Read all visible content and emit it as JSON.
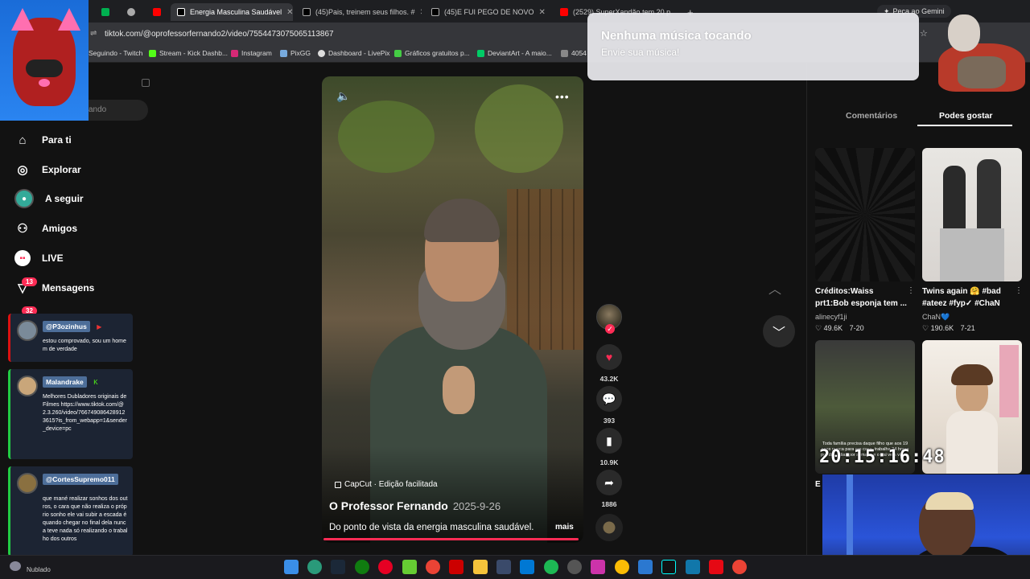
{
  "browser": {
    "tabs": [
      {
        "label": "",
        "active": false
      },
      {
        "label": "",
        "active": false
      },
      {
        "label": "",
        "active": false
      },
      {
        "label": "Energia Masculina Saudável",
        "active": true
      },
      {
        "label": "(45)Pais, treinem seus filhos. #",
        "active": false
      },
      {
        "label": "(45)E FUI PEGO DE NOVO",
        "active": false
      },
      {
        "label": "(2529) SuperXandão tem 20 p",
        "active": false
      }
    ],
    "gemini_label": "Peça ao Gemini",
    "url": "tiktok.com/@oprofessorfernando2/video/7554473075065113867",
    "bookmarks": [
      "Seguindo - Twitch",
      "Stream - Kick Dashb...",
      "Instagram",
      "PixGG",
      "Dashboard - LivePix",
      "Gráficos gratuitos p...",
      "DeviantArt - A maio...",
      "4054"
    ]
  },
  "sidebar": {
    "search_placeholder": "ando",
    "items": [
      {
        "label": "Para ti",
        "icon": "home-icon"
      },
      {
        "label": "Explorar",
        "icon": "compass-icon"
      },
      {
        "label": "A seguir",
        "icon": "following-icon"
      },
      {
        "label": "Amigos",
        "icon": "friends-icon"
      },
      {
        "label": "LIVE",
        "icon": "live-icon"
      },
      {
        "label": "Mensagens",
        "icon": "messages-icon"
      }
    ],
    "messages_badge": "13",
    "activity_badge": "32"
  },
  "chat": [
    {
      "user": "@P3ozinhus",
      "message": "estou comprovado, sou um homem de verdade"
    },
    {
      "user": "Malandrake",
      "message": "Melhores Dubladores originais de Filmes https://www.tiktok.com/@2.3.260/video/7667490864289123615?is_from_webapp=1&sender_device=pc"
    },
    {
      "user": "@CortesSupremo011",
      "message": "que mané realizar sonhos dos outros, o cara que não realiza o próprio sonho ele vai subir a escada é quando chegar no final dela nunca teve nada só realizando o trabalho dos outros"
    }
  ],
  "video": {
    "effect_label": "CapCut · Edição facilitada",
    "author": "O Professor Fernando",
    "date": "2025-9-26",
    "description": "Do ponto de vista da energia masculina saudável.",
    "more_label": "mais",
    "progress": 0.99
  },
  "actions": {
    "likes": "43.2K",
    "comments": "393",
    "saves": "10.9K",
    "shares": "1886"
  },
  "right_panel": {
    "tabs": [
      "Comentários",
      "Podes gostar"
    ],
    "active_tab": "Podes gostar",
    "cards": [
      {
        "title": "Créditos:Waiss prt1:Bob esponja tem ...",
        "user": "alinecyf1ji",
        "likes": "49.6K",
        "date": "7-20"
      },
      {
        "title": "Twins again 🤗 #bad #ateez #fyp✓ #ChaN",
        "user": "ChaN💙",
        "likes": "190.6K",
        "date": "7-21"
      },
      {
        "title": "E",
        "user": "",
        "likes": "",
        "date": "",
        "overlay_text": "Toda família precisa daque filho que aos 19 anos nunca para em casa, trabalha 24 horas por dia, 7dias por semana e o pai ve a vida..."
      },
      {
        "title": "",
        "user": "",
        "likes": "",
        "date": ""
      }
    ]
  },
  "notification": {
    "title": "Nenhuma música tocando",
    "subtitle": "Envie sua música!"
  },
  "overlay": {
    "clock": "20:15:16:48",
    "weather": "Nublado"
  },
  "colors": {
    "accent": "#fe2c55",
    "background": "#121212",
    "chat_card": "#1c2433"
  }
}
